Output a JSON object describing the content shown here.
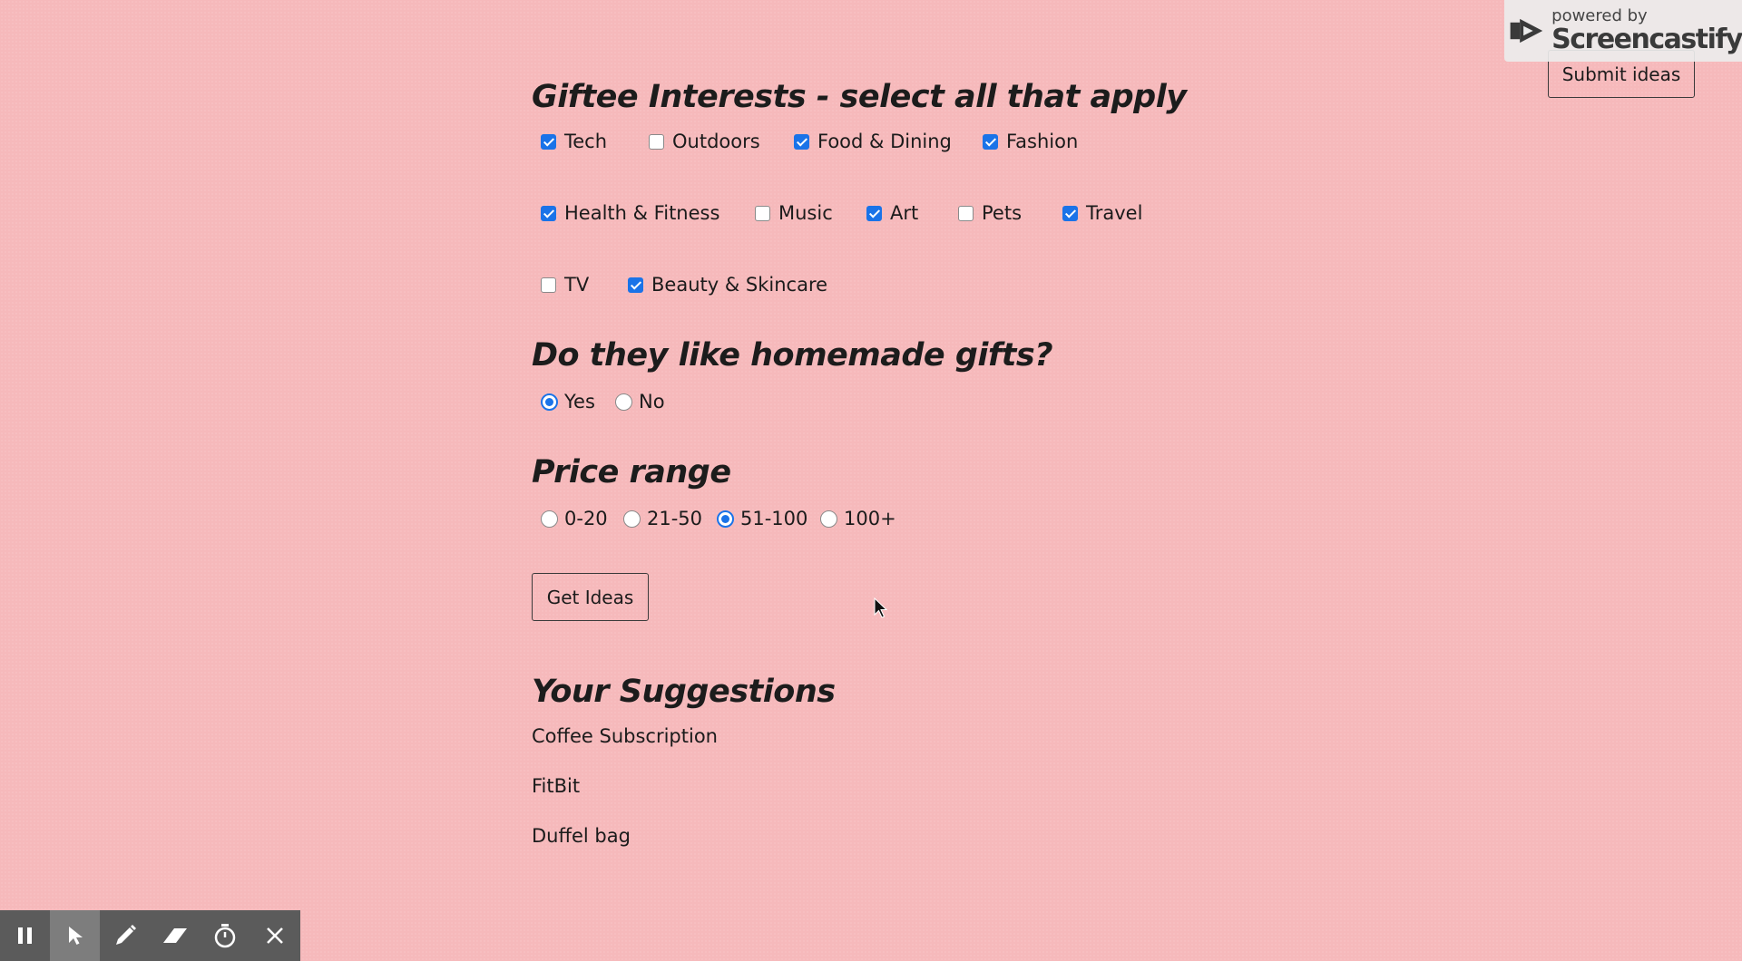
{
  "interests": {
    "heading": "Giftee Interests - select all that apply",
    "options": [
      {
        "label": "Tech",
        "checked": true
      },
      {
        "label": "Outdoors",
        "checked": false
      },
      {
        "label": "Food & Dining",
        "checked": true
      },
      {
        "label": "Fashion",
        "checked": true
      },
      {
        "label": "Health & Fitness",
        "checked": true
      },
      {
        "label": "Music",
        "checked": false
      },
      {
        "label": "Art",
        "checked": true
      },
      {
        "label": "Pets",
        "checked": false
      },
      {
        "label": "Travel",
        "checked": true
      },
      {
        "label": "TV",
        "checked": false
      },
      {
        "label": "Beauty & Skincare",
        "checked": true
      }
    ]
  },
  "homemade": {
    "heading": "Do they like homemade gifts?",
    "options": [
      {
        "label": "Yes",
        "selected": true
      },
      {
        "label": "No",
        "selected": false
      }
    ]
  },
  "price": {
    "heading": "Price range",
    "options": [
      {
        "label": "0-20",
        "selected": false
      },
      {
        "label": "21-50",
        "selected": false
      },
      {
        "label": "51-100",
        "selected": true
      },
      {
        "label": "100+",
        "selected": false
      }
    ]
  },
  "get_ideas_label": "Get Ideas",
  "suggestions": {
    "heading": "Your Suggestions",
    "items": [
      "Coffee Subscription",
      "FitBit",
      "Duffel bag"
    ]
  },
  "submit_label": "Submit ideas",
  "watermark": {
    "small": "powered by",
    "big": "Screencastify"
  },
  "recorder_toolbar": {
    "tools": [
      "pause-icon",
      "pointer-icon",
      "pen-icon",
      "eraser-icon",
      "timer-icon",
      "close-icon"
    ]
  },
  "colors": {
    "background": "#f6b9bb",
    "accent": "#1a73e8"
  }
}
